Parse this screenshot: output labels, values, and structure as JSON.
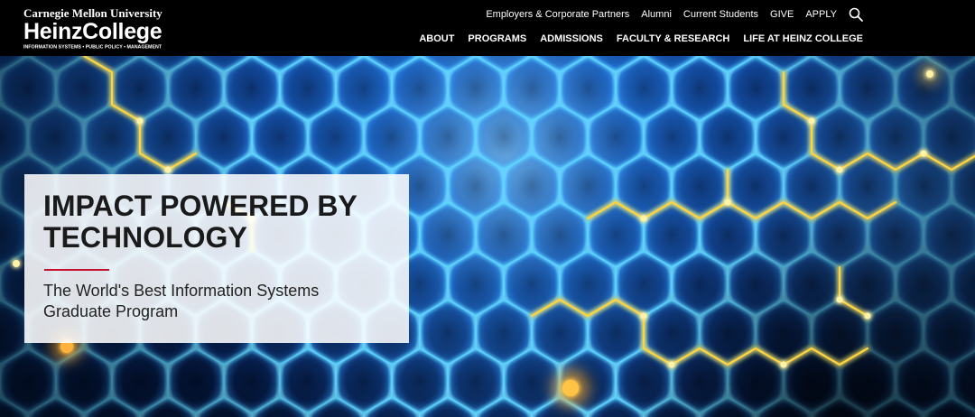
{
  "header": {
    "logo": {
      "university": "Carnegie Mellon University",
      "college": "HeinzCollege",
      "tagline": "INFORMATION SYSTEMS • PUBLIC POLICY • MANAGEMENT"
    },
    "utility_nav": [
      {
        "label": "Employers & Corporate Partners"
      },
      {
        "label": "Alumni"
      },
      {
        "label": "Current Students"
      },
      {
        "label": "GIVE"
      },
      {
        "label": "APPLY"
      }
    ],
    "search": {
      "icon": "search-icon"
    },
    "main_nav": [
      {
        "label": "ABOUT"
      },
      {
        "label": "PROGRAMS"
      },
      {
        "label": "ADMISSIONS"
      },
      {
        "label": "FACULTY & RESEARCH"
      },
      {
        "label": "LIFE AT HEINZ COLLEGE"
      }
    ]
  },
  "hero": {
    "title": "IMPACT POWERED BY TECHNOLOGY",
    "subtitle": "The World's Best Information Systems Graduate Program"
  },
  "colors": {
    "header_background": "#000000",
    "header_text": "#ffffff",
    "accent": "#c41230",
    "hex_glow": "#5fd6ff",
    "circuit_yellow": "#ffd23f"
  }
}
